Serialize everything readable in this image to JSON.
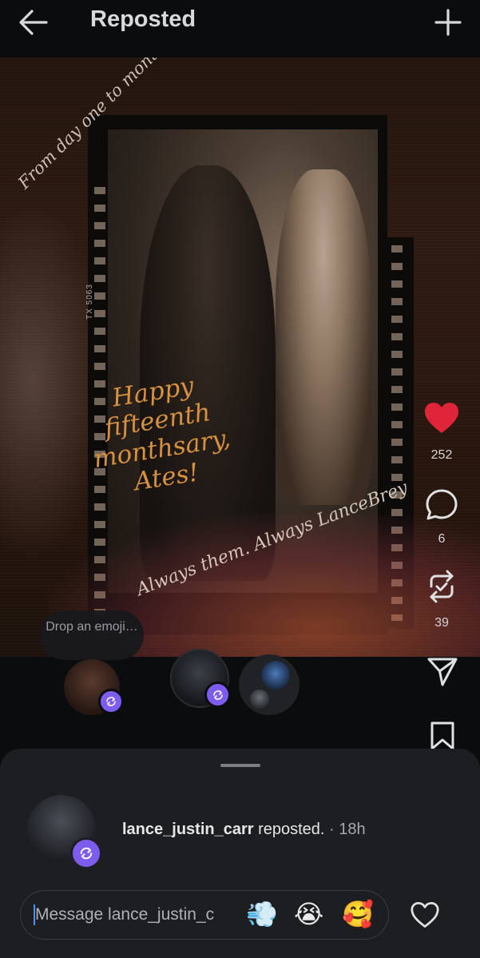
{
  "header": {
    "title": "Reposted",
    "back_icon": "arrow-left-icon",
    "add_icon": "plus-icon"
  },
  "post": {
    "photo_texts": {
      "film_code": "TX 5063",
      "top_script": "From day one to month fifteen...",
      "main_script": "Happy fifteenth monthsary, Ates!",
      "bottom_script": "Always them. Always LanceBrey"
    },
    "likes": "252",
    "comments": "6",
    "reposts": "39",
    "like_color": "#e0243a",
    "icons": [
      "heart-icon",
      "comment-icon",
      "repost-icon",
      "share-icon",
      "bookmark-icon"
    ]
  },
  "emoji_prompt": "Drop an emoji…",
  "sheet": {
    "username": "lance_justin_carr",
    "action": "reposted.",
    "time": "· 18h",
    "badge_color": "#7d5cf0",
    "message_placeholder": "Message lance_justin_c",
    "quick_emojis": [
      "💨",
      "😭",
      "🥰"
    ],
    "heart_icon": "heart-outline-icon"
  }
}
